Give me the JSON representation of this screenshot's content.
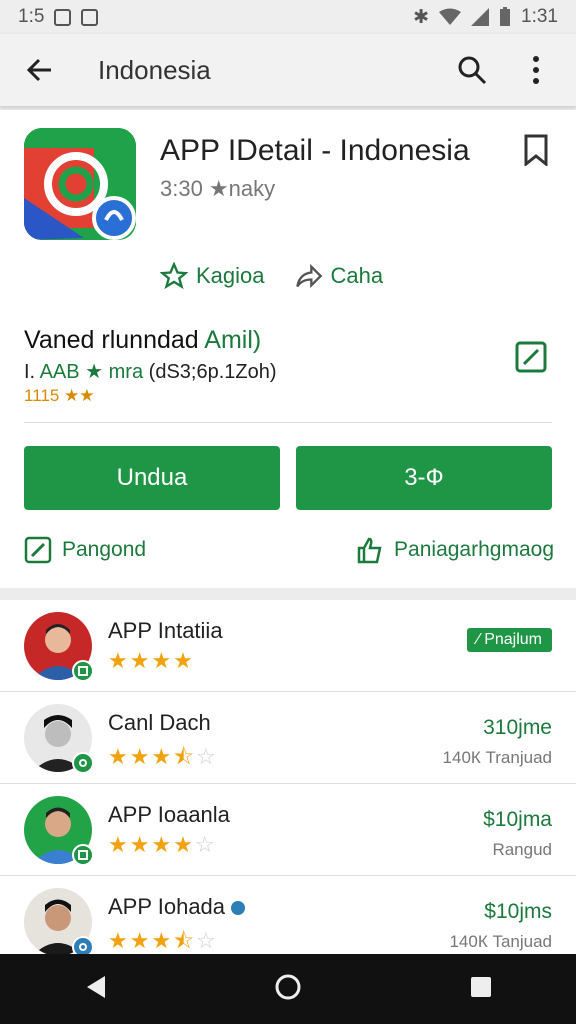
{
  "status_bar": {
    "time_left": "1:5",
    "time_right": "1:31"
  },
  "app_bar": {
    "title": "Indonesia"
  },
  "detail": {
    "title": "APP IDetail - Indonesia",
    "rating_text": "3:30 ★naky",
    "action_left": "Kagioa",
    "action_right": "Caha",
    "info_title_plain": "Vaned rlunndad",
    "info_title_green": "Amil)",
    "info_sub_prefix": "I.",
    "info_sub_green": "AAB ★ mra",
    "info_sub_rest": "(dS3;6p.1Zoh)",
    "info_rating": "1115 ★★",
    "install_label": "Undua",
    "second_label": "3-Ф",
    "link_left": "Pangond",
    "link_right": "Paniagarhgmaog"
  },
  "list": [
    {
      "name": "APP Intatiia",
      "stars": 4,
      "half": false,
      "tag": "∕ Pnajlum",
      "price": "",
      "sub": ""
    },
    {
      "name": "Canl Dach",
      "stars": 3,
      "half": true,
      "tag": "",
      "price": "310jme",
      "sub": "140К Tranjuad"
    },
    {
      "name": "APP Ioaanla",
      "stars": 4,
      "half": false,
      "tag": "",
      "price": "$10jma",
      "sub": "Rangud"
    },
    {
      "name": "APP Iohada",
      "stars": 3,
      "half": true,
      "tag": "",
      "price": "$10jms",
      "sub": "140К Tanjuad"
    }
  ],
  "colors": {
    "accent": "#1e9645",
    "star": "#f2a20c"
  }
}
